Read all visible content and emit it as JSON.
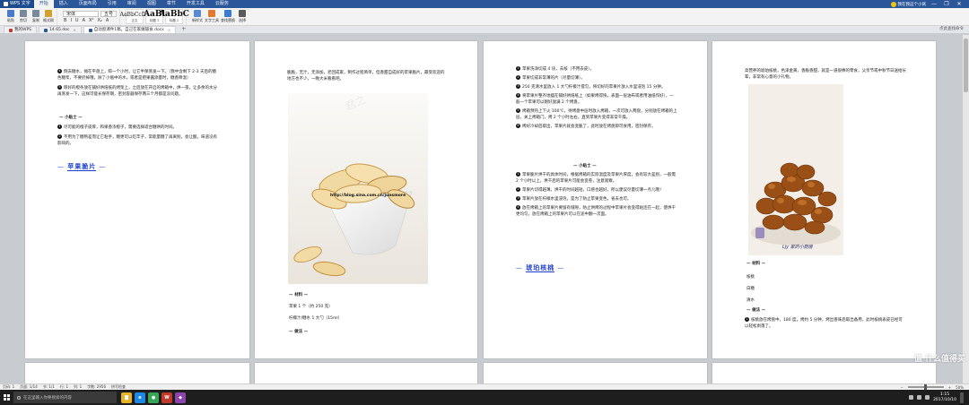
{
  "app": {
    "app_button": "WPS 文字",
    "menu": [
      "开始",
      "插入",
      "页面布局",
      "引用",
      "审阅",
      "视图",
      "章节",
      "开发工具",
      "云服务"
    ],
    "user_name": "我在我这个小窝",
    "window_controls": [
      "—",
      "❐",
      "✕"
    ]
  },
  "ribbon": {
    "clipboard": [
      {
        "label": "粘贴",
        "color": "#4a7bc8"
      },
      {
        "label": "剪切",
        "color": "#7a8a9a"
      },
      {
        "label": "复制",
        "color": "#7a8a9a"
      },
      {
        "label": "格式刷",
        "color": "#d0a030"
      }
    ],
    "font_name": "宋体",
    "font_size": "五号",
    "format_glyphs": [
      "B",
      "I",
      "U",
      "A",
      "X²",
      "X₂",
      "A"
    ],
    "styles": [
      {
        "sample": "AaBbCcDd",
        "name": "正文"
      },
      {
        "sample": "AaBl",
        "name": "标题 1"
      },
      {
        "sample": "AaBbC",
        "name": "标题 2"
      }
    ],
    "tools": [
      {
        "label": "新样式",
        "color": "#5a8ad0"
      },
      {
        "label": "文字工具",
        "color": "#e07a30"
      },
      {
        "label": "查找替换",
        "color": "#3a7ad0"
      },
      {
        "label": "选择",
        "color": "#5a5a5a"
      }
    ]
  },
  "tabs": {
    "items": [
      {
        "label": "我的WPS",
        "active": false,
        "color": "#c0392b"
      },
      {
        "label": "14.65.doc",
        "active": false,
        "color": "#2b579a"
      },
      {
        "label": "自动窗课件1稿，自己在家做辅食.docx",
        "active": true,
        "color": "#2b579a"
      }
    ],
    "add_label": "+",
    "right_text": "点此查找命令"
  },
  "pages": {
    "p1": {
      "items": [
        {
          "num": "4",
          "text": "倒去糖水，摊在平盘上，晾一个小时，让它半保蒸发一下。（我中含剩下 2-3 天后的糖色糖浆，不要扔掉哦，除了小瓶中的水，或者是把果酱添量时，糖香降温）"
        },
        {
          "num": "5",
          "text": "晾好的橙条放在铺好烘焙纸的烤架上，之后放在开启的烤箱中，烘一夜，让多余的水分再蒸发一下，这样可能长保存期，密封容器保存两三个月都是没问题。"
        }
      ],
      "tips_head": "— 小贴士 —",
      "tips": [
        {
          "num": "1",
          "text": "尽可能的橙子皮厚，和果香浓橙子，需要选择适合糖烘的时间。"
        },
        {
          "num": "2",
          "text": "不用为了糖熟差而让它粘手，糖更可以吃牢子，常能量糖了再离别，会让酸，味道没有影响的。"
        }
      ],
      "section_title": "苹果脆片"
    },
    "p2": {
      "intro": "脆脆，无汁，无添加，老回成家，制作过程简单，但香甜自成好的苹果脆片，最受欢迎的地方也不少，一晚大米看看吧。",
      "photo_url": "http://blog.sina.com.cn/junsmore",
      "material_head": "— 材料 —",
      "materials": [
        "苹果 1 个（约 250 克）",
        "柠檬汁/糖水 1 大勺（15ml）"
      ],
      "method_head": "— 做法 —"
    },
    "p3": {
      "items": [
        {
          "num": "1",
          "text": "苹果洗净切成 4 块，去核（不用去皮）。"
        },
        {
          "num": "2",
          "text": "苹果切成非常薄的片（尽量切薄）。"
        },
        {
          "num": "3",
          "text": "250 克清水里放入 1 大勺柠檬汁搅匀，将切好的苹果片放入水里浸泡 15 分钟。"
        },
        {
          "num": "4",
          "text": "将苹果片整齐地摆在铺好烘焙纸上（如果烤得快，表面一层油布或者用油纸作好），一般一个苹果可以刚好放满 2 个烤盘。"
        },
        {
          "num": "5",
          "text": "烤箱预热上下火 100℃，待烤盘中层时放入烤箱，一次可放入两盘，分别放在烤箱的上层，关上烤箱门，烤 2 个小时左右，直到苹果片变得非常干燥。"
        },
        {
          "num": "6",
          "text": "烤好冷却后取出，苹果片就会变脆了，此时放在烤盘即可食用，密封保存。"
        }
      ],
      "tips_head": "— 小贴士 —",
      "tips": [
        {
          "num": "1",
          "text": "苹果脆片烘干的具体时间，根据烤箱的实际温度及苹果片厚度，会有较大差别，一般需 2 个小时以上，烘干后的苹果片可能会变卷，注意观察。"
        },
        {
          "num": "2",
          "text": "苹果片切得越薄，烘干的时间越短，口感也越好，所以建议尽量切薄一点儿哦！"
        },
        {
          "num": "3",
          "text": "苹果片放在柠檬水里浸泡，是为了防止苹果变色，省去也可。"
        },
        {
          "num": "4",
          "text": "放在烤箱上的苹果片要留有缝隙，防止烘烤的过程中苹果片会变得粘连在一起，使烘干更均匀，放在烤箱上的苹果片可以在途中翻一次面。"
        }
      ],
      "section_title": "琥珀核桃"
    },
    "p4": {
      "intro": "高营养的琥珀核桃，色泽金黄，香脆香甜，就是一道很棒的零食，父亲节或中秋节日送给长辈，非常有心意的小礼物。",
      "photo_caption": "Ljy 家的小厨房",
      "material_head": "— 材料 —",
      "materials": [
        "核桃",
        "白糖",
        "清水"
      ],
      "method_head": "— 做法 —",
      "method": [
        {
          "num": "1",
          "text": "核桃放在烤盘中，180 度，烤约 5 分钟，烤出香味后取出备用，此时核桃表皮已经可以轻松剥落了。"
        }
      ]
    },
    "watermark": "君之"
  },
  "statusbar": {
    "left": [
      "页码: 1",
      "页面: 1/14",
      "节: 1/1",
      "行: 1",
      "列: 1",
      "字数: 2956",
      "拼写检查"
    ],
    "zoom": "50%"
  },
  "taskbar": {
    "search_placeholder": "在这里输入你要搜索的内容",
    "apps": [
      {
        "name": "file-explorer",
        "color": "#e6b422",
        "glyph": "▇"
      },
      {
        "name": "browser",
        "color": "#1e88e5",
        "glyph": "e"
      },
      {
        "name": "chrome",
        "color": "#34a853",
        "glyph": "●"
      },
      {
        "name": "wps",
        "color": "#c0392b",
        "glyph": "W"
      },
      {
        "name": "app5",
        "color": "#8e44ad",
        "glyph": "◆"
      }
    ],
    "time": "1:15",
    "date": "2017/10/10",
    "brand_overlay": "值 什么值得买"
  }
}
